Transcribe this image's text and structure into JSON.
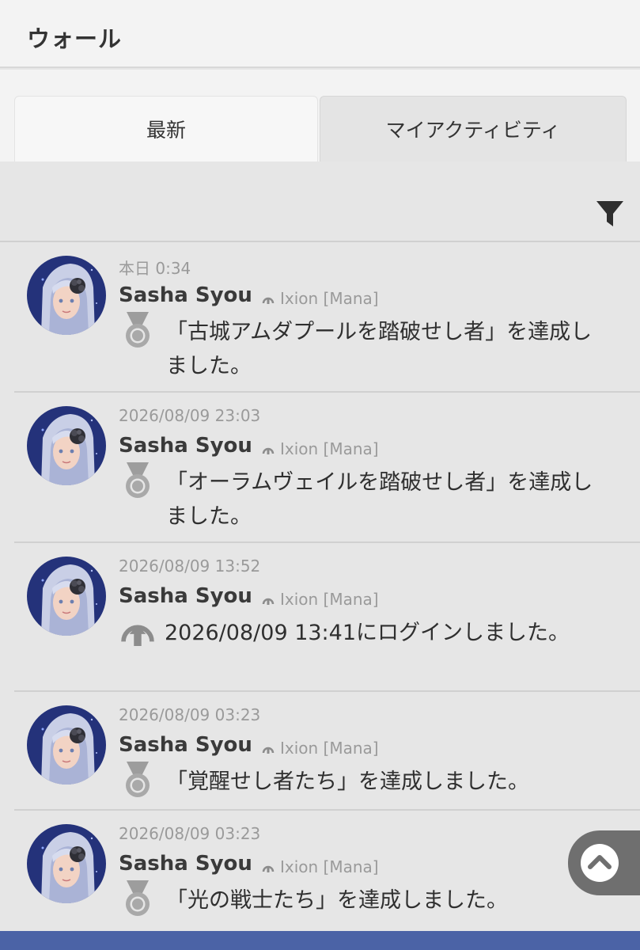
{
  "header": {
    "title": "ウォール"
  },
  "tabs": [
    {
      "label": "最新"
    },
    {
      "label": "マイアクティビティ"
    }
  ],
  "entries": [
    {
      "time": "本日 0:34",
      "name": "Sasha Syou",
      "world": "Ixion [Mana]",
      "icon": "medal-icon",
      "text": "「古城アムダプールを踏破せし者」を達成しました。"
    },
    {
      "time": "2026/08/09 23:03",
      "name": "Sasha Syou",
      "world": "Ixion [Mana]",
      "icon": "medal-icon",
      "text": "「オーラムヴェイルを踏破せし者」を達成しました。"
    },
    {
      "time": "2026/08/09 13:52",
      "name": "Sasha Syou",
      "world": "Ixion [Mana]",
      "icon": "login-icon",
      "text": "2026/08/09 13:41にログインしました。"
    },
    {
      "time": "2026/08/09 03:23",
      "name": "Sasha Syou",
      "world": "Ixion [Mana]",
      "icon": "medal-icon",
      "text": "「覚醒せし者たち」を達成しました。"
    },
    {
      "time": "2026/08/09 03:23",
      "name": "Sasha Syou",
      "world": "Ixion [Mana]",
      "icon": "medal-icon",
      "text": "「光の戦士たち」を達成しました。"
    }
  ],
  "colors": {
    "background": "#e6e6e6",
    "header_bg": "#f3f3f3",
    "bottom_bar": "#4b63a6",
    "muted_text": "#9a9a9a",
    "scroll_button": "#6f6f6f"
  }
}
